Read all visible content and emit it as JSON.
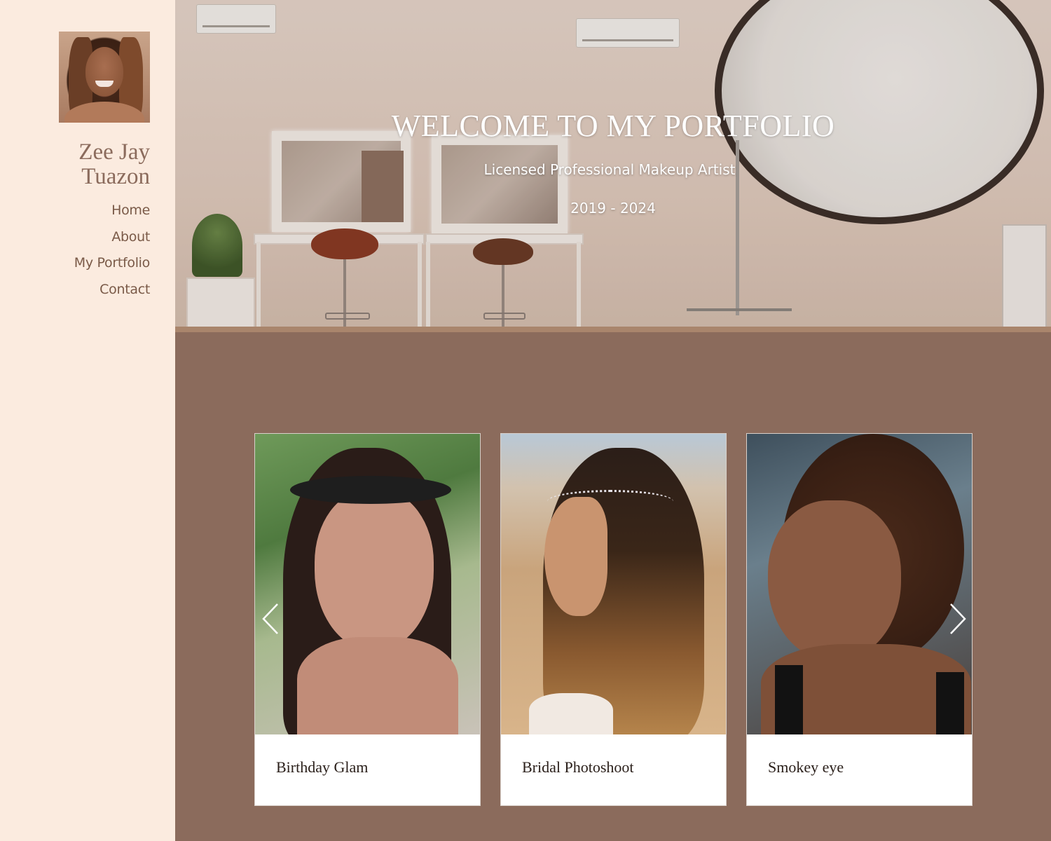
{
  "sidebar": {
    "name_line1": "Zee Jay",
    "name_line2": "Tuazon",
    "nav": [
      {
        "label": "Home"
      },
      {
        "label": "About"
      },
      {
        "label": "My Portfolio"
      },
      {
        "label": "Contact"
      }
    ]
  },
  "hero": {
    "title": "WELCOME TO MY PORTFOLIO",
    "subtitle": "Licensed Professional Makeup Artist",
    "years": "2019 - 2024"
  },
  "portfolio": {
    "cards": [
      {
        "caption": "Birthday Glam"
      },
      {
        "caption": "Bridal Photoshoot"
      },
      {
        "caption": "Smokey eye"
      }
    ],
    "prev_icon": "chevron-left-icon",
    "next_icon": "chevron-right-icon"
  },
  "colors": {
    "sidebar_bg": "#fbebdf",
    "main_bg": "#8b6b5c",
    "name_color": "#8b6b5c",
    "nav_color": "#7a5a48"
  }
}
